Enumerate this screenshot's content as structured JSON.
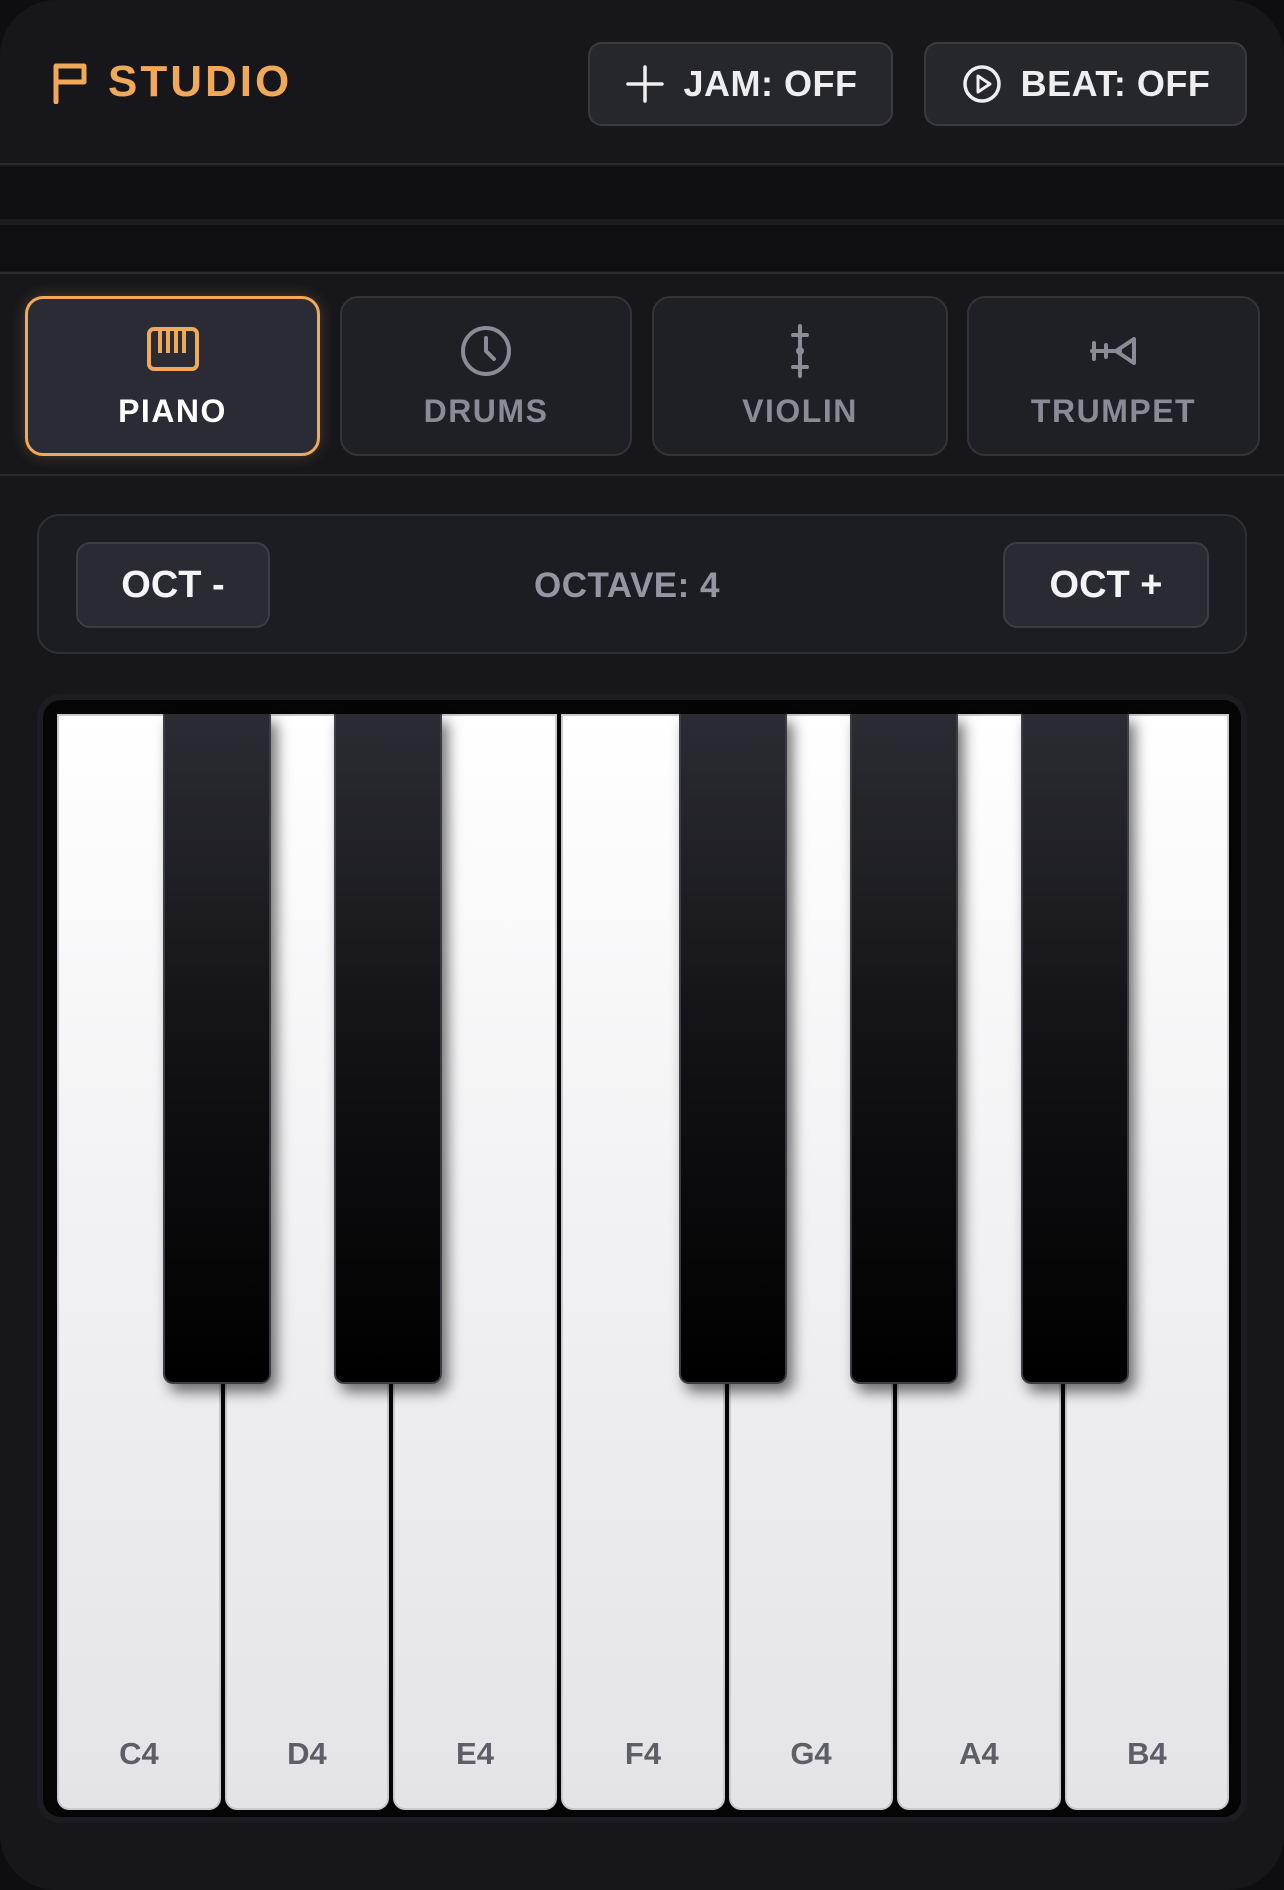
{
  "header": {
    "brand": "STUDIO",
    "jam_label": "JAM: OFF",
    "beat_label": "BEAT: OFF"
  },
  "instruments": [
    {
      "label": "PIANO",
      "icon": "piano-icon",
      "active": true
    },
    {
      "label": "DRUMS",
      "icon": "clock-icon",
      "active": false
    },
    {
      "label": "VIOLIN",
      "icon": "violin-icon",
      "active": false
    },
    {
      "label": "TRUMPET",
      "icon": "trumpet-icon",
      "active": false
    }
  ],
  "octave": {
    "minus_label": "OCT -",
    "plus_label": "OCT +",
    "readout": "OCTAVE: 4"
  },
  "keys": {
    "white": [
      "C4",
      "D4",
      "E4",
      "F4",
      "G4",
      "A4",
      "B4"
    ],
    "black_count": 5
  },
  "colors": {
    "accent": "#f0a95a",
    "background": "#17171b"
  }
}
